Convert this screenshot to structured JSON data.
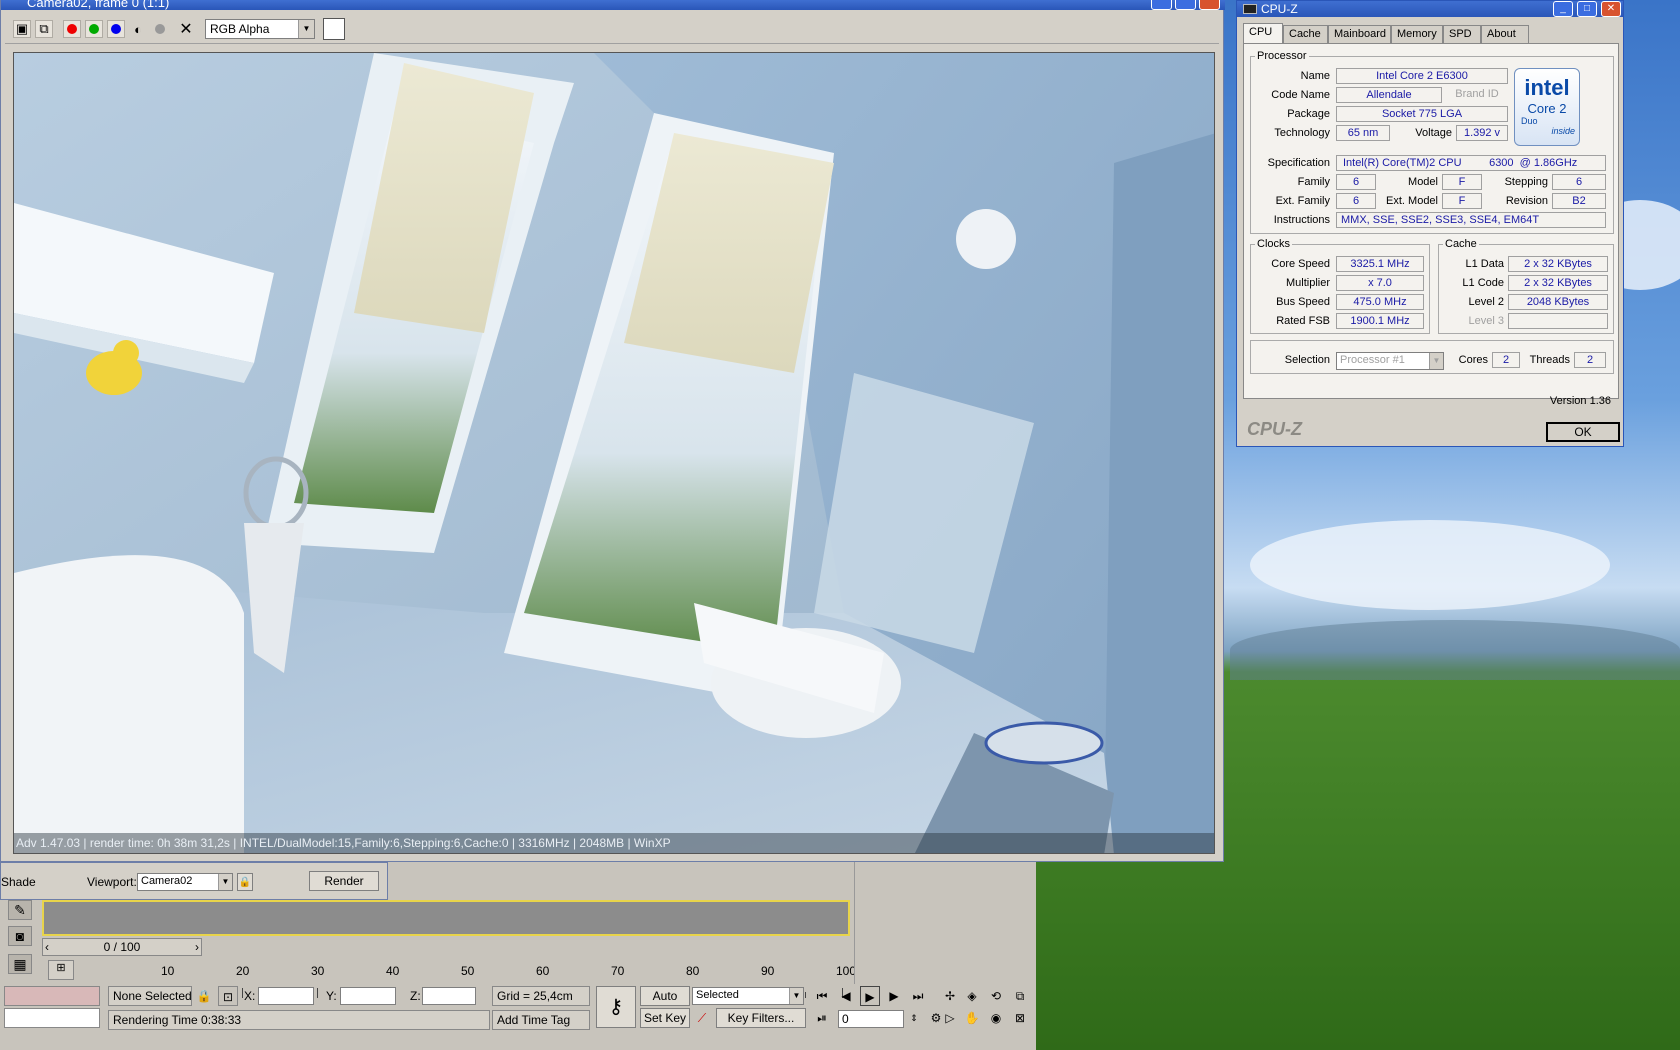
{
  "render_window": {
    "title": "Camera02, frame 0 (1:1)",
    "channel": "RGB Alpha",
    "status_line": "Adv 1.47.03 | render time: 0h 38m 31,2s | INTEL/DualModel:15,Family:6,Stepping:6,Cache:0 | 3316MHz | 2048MB | WinXP"
  },
  "cpuz": {
    "title": "CPU-Z",
    "tabs": [
      "CPU",
      "Cache",
      "Mainboard",
      "Memory",
      "SPD",
      "About"
    ],
    "processor_legend": "Processor",
    "name_label": "Name",
    "name": "Intel Core 2 E6300",
    "codename_label": "Code Name",
    "codename": "Allendale",
    "brandid_label": "Brand ID",
    "package_label": "Package",
    "package": "Socket 775 LGA",
    "technology_label": "Technology",
    "technology": "65 nm",
    "voltage_label": "Voltage",
    "voltage": "1.392 v",
    "spec_label": "Specification",
    "spec": "Intel(R) Core(TM)2 CPU         6300  @ 1.86GHz",
    "family_label": "Family",
    "family": "6",
    "model_label": "Model",
    "model": "F",
    "stepping_label": "Stepping",
    "stepping": "6",
    "extfamily_label": "Ext. Family",
    "extfamily": "6",
    "extmodel_label": "Ext. Model",
    "extmodel": "F",
    "revision_label": "Revision",
    "revision": "B2",
    "instructions_label": "Instructions",
    "instructions": "MMX, SSE, SSE2, SSE3, SSE4, EM64T",
    "clocks_legend": "Clocks",
    "corespeed_label": "Core Speed",
    "corespeed": "3325.1 MHz",
    "multiplier_label": "Multiplier",
    "multiplier": "x 7.0",
    "busspeed_label": "Bus Speed",
    "busspeed": "475.0 MHz",
    "ratedfsb_label": "Rated FSB",
    "ratedfsb": "1900.1 MHz",
    "cache_legend": "Cache",
    "l1data_label": "L1 Data",
    "l1data": "2 x 32 KBytes",
    "l1code_label": "L1 Code",
    "l1code": "2 x 32 KBytes",
    "level2_label": "Level 2",
    "level2": "2048 KBytes",
    "level3_label": "Level 3",
    "selection_label": "Selection",
    "selection": "Processor #1",
    "cores_label": "Cores",
    "cores": "2",
    "threads_label": "Threads",
    "threads": "2",
    "version": "Version 1.36",
    "brand": "CPU-Z",
    "ok": "OK",
    "logo_intel": "intel",
    "logo_core2": "Core 2",
    "logo_duo": "Duo",
    "logo_inside": "inside"
  },
  "max": {
    "shade_label": "Shade",
    "viewport_label": "Viewport:",
    "viewport": "Camera02",
    "render_button": "Render",
    "frame_counter": "0 / 100",
    "ticks": [
      "10",
      "20",
      "30",
      "40",
      "50",
      "60",
      "70",
      "80",
      "90",
      "100"
    ],
    "selection_status": "None Selected",
    "x_label": "X:",
    "y_label": "Y:",
    "z_label": "Z:",
    "grid": "Grid = 25,4cm",
    "rendering_time": "Rendering Time  0:38:33",
    "add_time_tag": "Add Time Tag",
    "auto_key": "Auto Key",
    "set_key": "Set Key",
    "key_mode": "Selected",
    "key_filters": "Key Filters...",
    "frame_value": "0"
  }
}
